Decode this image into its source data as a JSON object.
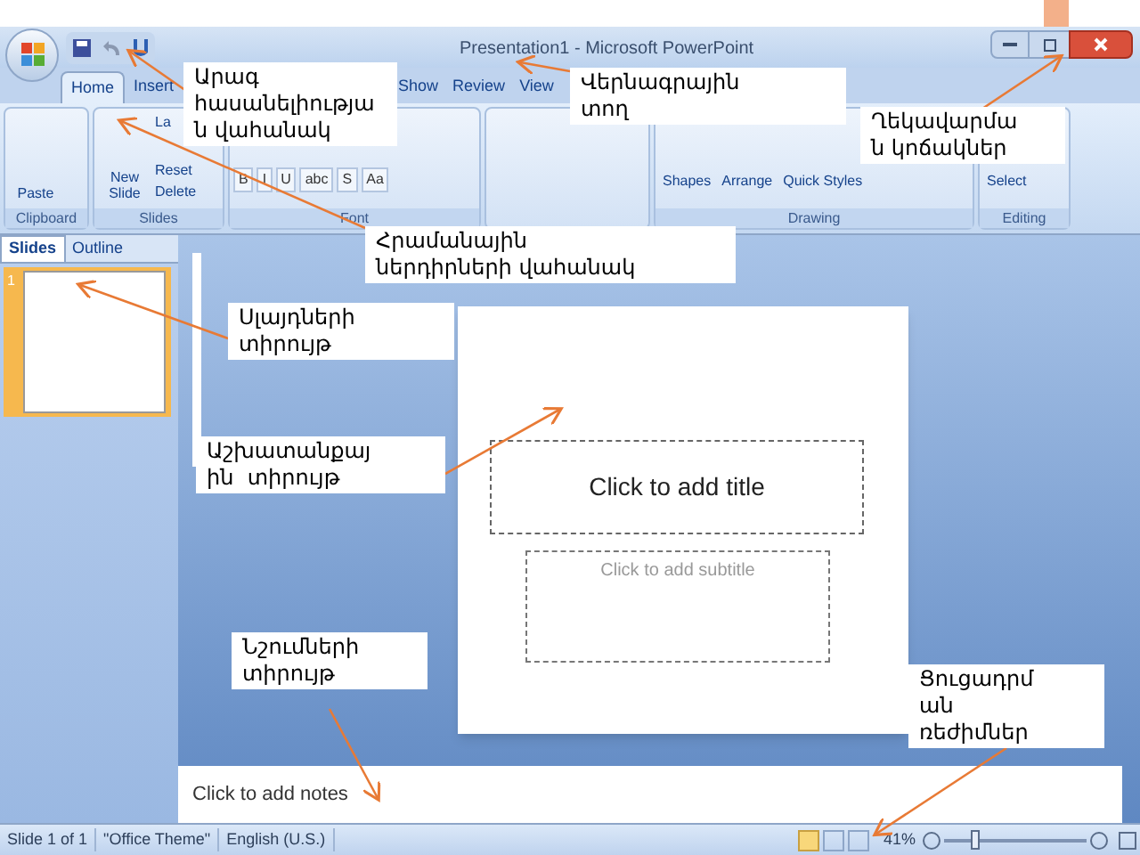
{
  "window": {
    "title": "Presentation1 - Microsoft PowerPoint"
  },
  "ribbon_tabs": [
    {
      "label": "Home",
      "selected": true
    },
    {
      "label": "Insert",
      "selected": false
    },
    {
      "label": "Show",
      "selected": false
    },
    {
      "label": "Review",
      "selected": false
    },
    {
      "label": "View",
      "selected": false
    }
  ],
  "ribbon_groups": [
    {
      "kind": "clipboard",
      "label": "Clipboard",
      "buttons": [
        "Paste"
      ]
    },
    {
      "kind": "slides",
      "label": "Slides",
      "buttons": [
        "New Slide",
        "La",
        "Reset",
        "Delete"
      ]
    },
    {
      "kind": "font",
      "label": "Font",
      "buttons": [
        "B",
        "I",
        "U",
        "abc",
        "S",
        "Aa"
      ]
    },
    {
      "kind": "paragraph"
    },
    {
      "kind": "drawing",
      "label": "Drawing",
      "buttons": [
        "Shapes",
        "Arrange",
        "Quick Styles"
      ]
    },
    {
      "kind": "editing",
      "label": "Editing",
      "buttons": [
        "Select"
      ]
    }
  ],
  "panel_tabs": [
    {
      "label": "Slides",
      "selected": true
    },
    {
      "label": "Outline",
      "selected": false
    }
  ],
  "slide_thumbnails": [
    {
      "number": "1",
      "selected": true
    }
  ],
  "slide": {
    "title_placeholder": "Click to add title",
    "subtitle_placeholder": "Click to add subtitle"
  },
  "notes": {
    "placeholder": "Click to add notes"
  },
  "status_bar": {
    "slide": "Slide 1 of 1",
    "theme": "\"Office Theme\"",
    "language": "English (U.S.)",
    "zoom": "41%",
    "zoom_slider": {
      "level": 0.2
    }
  },
  "callouts": [
    {
      "lines": [
        "Արագ",
        "հասանելիությա",
        "ն վահանակ"
      ]
    },
    {
      "lines": [
        "Վերնագրային",
        "տող"
      ]
    },
    {
      "lines": [
        "Ղեկավարմա",
        "ն կոճակներ"
      ]
    },
    {
      "lines": [
        "Հրամանային",
        "ներդիրների վահանակ"
      ]
    },
    {
      "lines": [
        "Սլայդների",
        "տիրույթ"
      ]
    },
    {
      "lines": [
        "Աշխատանքայ",
        "ին  տիրույթ"
      ]
    },
    {
      "lines": [
        "Նշումների",
        "տիրույթ"
      ]
    },
    {
      "lines": [
        "Ցուցադրմ",
        "ան",
        "ռեժիմներ"
      ]
    }
  ]
}
